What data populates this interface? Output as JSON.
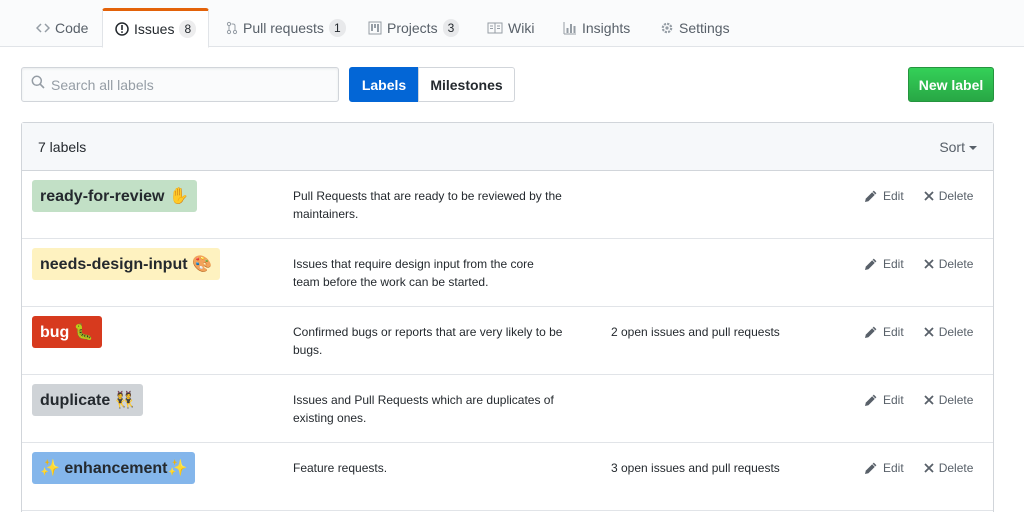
{
  "tabs": [
    {
      "label": "Code",
      "icon": "code-icon",
      "counter": null,
      "selected": false
    },
    {
      "label": "Issues",
      "icon": "issue-opened-icon",
      "counter": "8",
      "selected": true
    },
    {
      "label": "Pull requests",
      "icon": "git-pull-request-icon",
      "counter": "1",
      "selected": false
    },
    {
      "label": "Projects",
      "icon": "project-icon",
      "counter": "3",
      "selected": false
    },
    {
      "label": "Wiki",
      "icon": "book-icon",
      "counter": null,
      "selected": false
    },
    {
      "label": "Insights",
      "icon": "graph-icon",
      "counter": null,
      "selected": false
    },
    {
      "label": "Settings",
      "icon": "gear-icon",
      "counter": null,
      "selected": false
    }
  ],
  "toolbar": {
    "search_placeholder": "Search all labels",
    "search_value": "",
    "labels_button": "Labels",
    "milestones_button": "Milestones",
    "new_label_button": "New label"
  },
  "list": {
    "count_text": "7 labels",
    "sort_label": "Sort",
    "edit_label": "Edit",
    "delete_label": "Delete",
    "labels": [
      {
        "name": "ready-for-review ✋",
        "bg": "#c2e0c6",
        "fg": "#24292e",
        "description": "Pull Requests that are ready to be reviewed by the maintainers.",
        "issues": ""
      },
      {
        "name": "needs-design-input 🎨",
        "bg": "#fef2c0",
        "fg": "#24292e",
        "description": "Issues that require design input from the core team before the work can be started.",
        "issues": ""
      },
      {
        "name": "bug 🐛",
        "bg": "#d73a1e",
        "fg": "#ffffff",
        "description": "Confirmed bugs or reports that are very likely to be bugs.",
        "issues": "2 open issues and pull requests"
      },
      {
        "name": "duplicate 👯",
        "bg": "#cfd3d7",
        "fg": "#24292e",
        "description": "Issues and Pull Requests which are duplicates of existing ones.",
        "issues": ""
      },
      {
        "name": "✨ enhancement✨",
        "bg": "#84b6eb",
        "fg": "#24292e",
        "description": "Feature requests.",
        "issues": "3 open issues and pull requests"
      }
    ]
  },
  "colors": {
    "accent_tab": "#e36209",
    "primary_blue": "#0366d6",
    "new_label_green": "#28a745"
  }
}
